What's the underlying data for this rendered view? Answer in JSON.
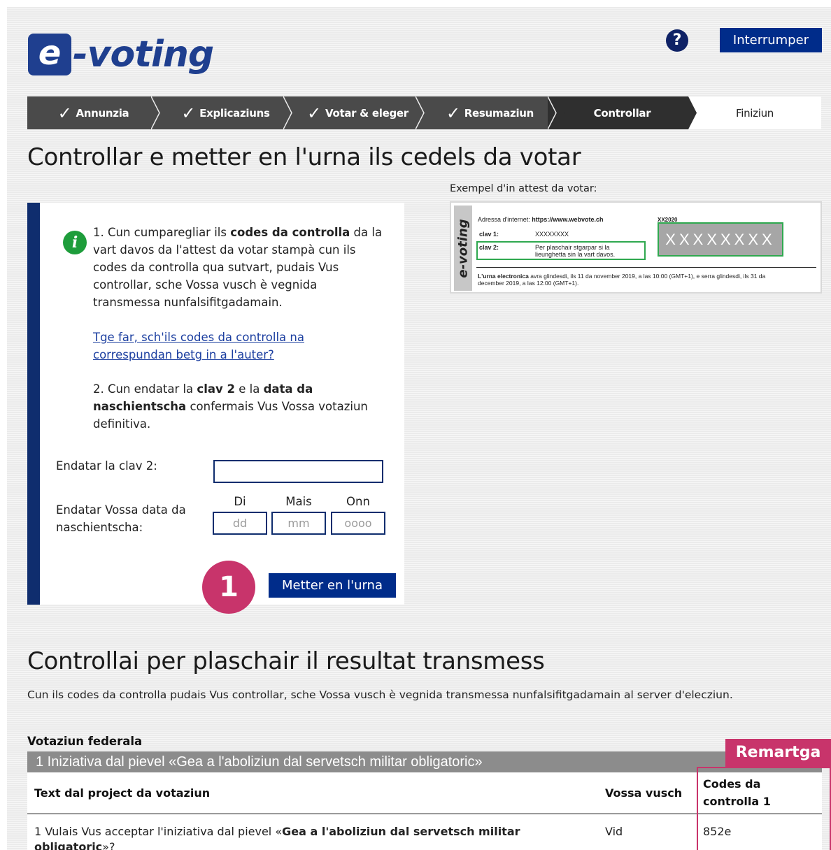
{
  "header": {
    "logo_e": "e",
    "logo_text": "-voting",
    "help_icon": "?",
    "interrupt_label": "Interrumper"
  },
  "steps": [
    {
      "label": "Annunzia",
      "state": "done"
    },
    {
      "label": "Explicaziuns",
      "state": "done"
    },
    {
      "label": "Votar & eleger",
      "state": "done"
    },
    {
      "label": "Resumaziun",
      "state": "done"
    },
    {
      "label": "Controllar",
      "state": "current"
    },
    {
      "label": "Finiziun",
      "state": "future"
    }
  ],
  "main": {
    "title": "Controllar e metter en l'urna ils cedels da votar",
    "info_icon": "i",
    "p1_a": "1. Cun cumparegliar ils ",
    "p1_b": "codes da controlla",
    "p1_c": " da la vart davos da l'attest da votar stampà cun ils codes da controlla qua sutvart, pudais Vus controllar, sche Vossa vusch è vegnida transmessa nunfalsifitgadamain.",
    "link": "Tge far, sch'ils codes da controlla na correspundan betg in a l'auter?",
    "p2_a": "2. Cun endatar la ",
    "p2_b": "clav 2",
    "p2_c": " e la ",
    "p2_d": "data da naschientscha",
    "p2_e": " confermais Vus Vossa votaziun definitiva.",
    "clav_label": "Endatar la clav 2:",
    "date_label": "Endatar Vossa data da naschientscha:",
    "date_day_head": "Di",
    "date_month_head": "Mais",
    "date_year_head": "Onn",
    "date_day_placeholder": "dd",
    "date_month_placeholder": "mm",
    "date_year_placeholder": "oooo",
    "step_badge": "1",
    "submit_label": "Metter en l'urna"
  },
  "example": {
    "label": "Exempel d'in attest da votar:",
    "side_logo": "e-voting",
    "url_label": "Adressa d'internet:",
    "url_value": "https://www.webvote.ch",
    "clav1_label": "clav 1:",
    "clav1_value": "XXXXXXXX",
    "clav2_label": "clav 2:",
    "clav2_value": "Per plaschair stgarpar si la lieunghetta sin la vart davos.",
    "code": "XX2020",
    "code_box": "XXXXXXXX",
    "urn_bold": "L'urna electronica",
    "urn_text": " avra glindesdi, ils 11 da november 2019, a las 10:00 (GMT+1), e serra glindesdi, ils 31 da december 2019, a las 12:00 (GMT+1)."
  },
  "result": {
    "title": "Controllai per plaschair il resultat transmess",
    "description": "Cun ils codes da controlla pudais Vus controllar, sche Vossa vusch è vegnida transmessa nunfalsifitgadamain al server d'elecziun.",
    "section_heading": "Votaziun federala",
    "question_title": "1 Iniziativa dal pievel «Gea a l'aboliziun dal servetsch militar obligatoric»",
    "col_text": "Text dal project da votaziun",
    "col_vote": "Vossa vusch",
    "col_code": "Codes da controlla 1",
    "row_text_a": "1 Vulais Vus acceptar l'iniziativa dal pievel «",
    "row_text_b": "Gea a l'aboliziun dal servetsch militar obligatoric",
    "row_text_c": "»?",
    "row_vote": "Vid",
    "row_code": "852e",
    "remark_badge": "Remartga"
  },
  "colors": {
    "brand_blue": "#1f3f8f",
    "nav_dark": "#0f2d6e",
    "button_blue": "#002c8a",
    "info_green": "#1e9d3b",
    "annotation_magenta": "#c8346b"
  }
}
